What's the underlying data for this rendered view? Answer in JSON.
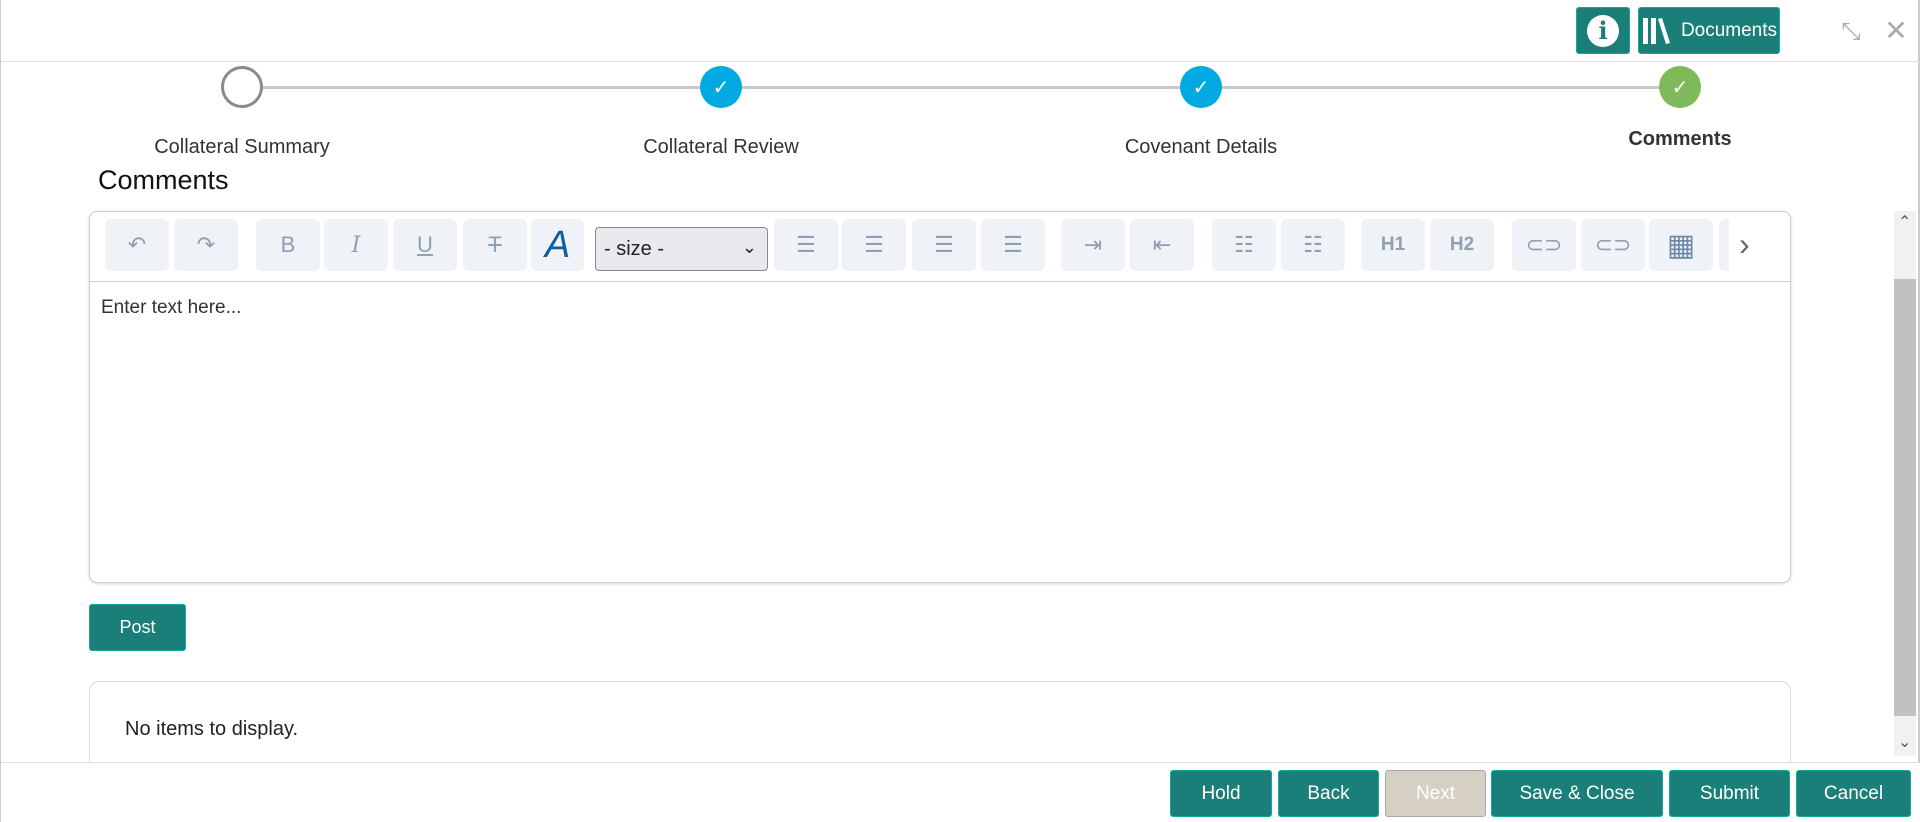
{
  "header": {
    "info_icon": "info-icon",
    "documents_label": "Documents",
    "minimize_icon": "minimize-icon",
    "close_icon": "close-icon"
  },
  "stepper": {
    "steps": [
      {
        "label": "Collateral Summary",
        "state": "current"
      },
      {
        "label": "Collateral Review",
        "state": "done"
      },
      {
        "label": "Covenant Details",
        "state": "done"
      },
      {
        "label": "Comments",
        "state": "done-active"
      }
    ]
  },
  "section_title": "Comments",
  "editor": {
    "size_select": "- size -",
    "placeholder": "Enter text here...",
    "toolbar": {
      "h1": "H1",
      "h2": "H2",
      "font_color": "A"
    }
  },
  "post_label": "Post",
  "comments_list": {
    "empty_text": "No items to display."
  },
  "footer": {
    "hold": "Hold",
    "back": "Back",
    "next": "Next",
    "save_close": "Save & Close",
    "submit": "Submit",
    "cancel": "Cancel"
  },
  "colors": {
    "accent": "#1b7f79",
    "step_done": "#00a9e0",
    "step_final": "#7fba5a",
    "disabled": "#d6d0c4"
  }
}
